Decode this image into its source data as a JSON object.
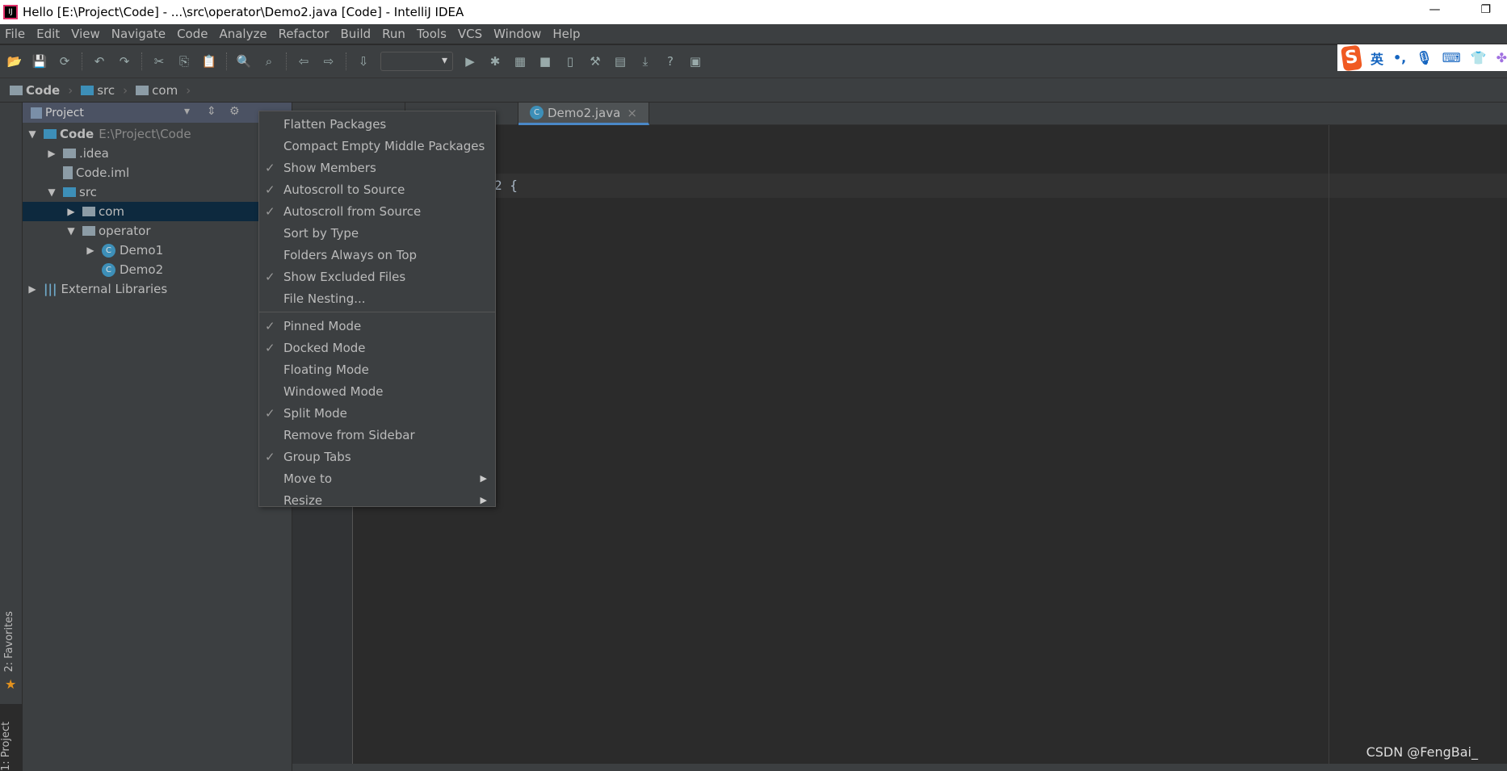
{
  "window": {
    "title": "Hello [E:\\Project\\Code] - ...\\src\\operator\\Demo2.java [Code] - IntelliJ IDEA",
    "minimize": "—",
    "restore": "❐"
  },
  "menubar": [
    "File",
    "Edit",
    "View",
    "Navigate",
    "Code",
    "Analyze",
    "Refactor",
    "Build",
    "Run",
    "Tools",
    "VCS",
    "Window",
    "Help"
  ],
  "toolbar": {
    "icons": [
      "open-folder",
      "save",
      "sync",
      "undo",
      "redo",
      "cut",
      "copy",
      "paste",
      "find",
      "replace",
      "back",
      "forward",
      "build",
      "run",
      "debug",
      "coverage",
      "stop",
      "device",
      "project-structure",
      "sdk",
      "vcs-update",
      "help",
      "sdk-manager"
    ]
  },
  "ime": {
    "logo": "S",
    "lang": "英",
    "punct": "•,"
  },
  "breadcrumb": [
    "Code",
    "src",
    "com"
  ],
  "stripe": {
    "favorites": "2: Favorites",
    "project": "1: Project"
  },
  "panel": {
    "title": "Project",
    "tree": [
      {
        "label": "Code",
        "extra": "E:\\Project\\Code",
        "arrow": "▼",
        "depth": 0,
        "icon": "module"
      },
      {
        "label": ".idea",
        "arrow": "▶",
        "depth": 1,
        "icon": "folder"
      },
      {
        "label": "Code.iml",
        "arrow": "",
        "depth": 1,
        "icon": "file"
      },
      {
        "label": "src",
        "arrow": "▼",
        "depth": 1,
        "icon": "source-folder"
      },
      {
        "label": "com",
        "arrow": "▶",
        "depth": 2,
        "icon": "package",
        "selected": true
      },
      {
        "label": "operator",
        "arrow": "▼",
        "depth": 2,
        "icon": "package"
      },
      {
        "label": "Demo1",
        "arrow": "▶",
        "depth": 3,
        "icon": "class"
      },
      {
        "label": "Demo2",
        "arrow": "",
        "depth": 3,
        "icon": "class"
      },
      {
        "label": "External Libraries",
        "arrow": "▶",
        "depth": 0,
        "icon": "libraries"
      }
    ]
  },
  "tabs": [
    {
      "label": ""
    },
    {
      "label": ""
    },
    {
      "label": "Demo2.java",
      "close": "×",
      "active": true
    }
  ],
  "editor": {
    "visible_code": "2 {"
  },
  "context_menu": [
    {
      "label": "Flatten Packages",
      "checked": false
    },
    {
      "label": "Compact Empty Middle Packages",
      "checked": false
    },
    {
      "label": "Show Members",
      "checked": true
    },
    {
      "label": "Autoscroll to Source",
      "checked": true
    },
    {
      "label": "Autoscroll from Source",
      "checked": true
    },
    {
      "label": "Sort by Type",
      "checked": false
    },
    {
      "label": "Folders Always on Top",
      "checked": false
    },
    {
      "label": "Show Excluded Files",
      "checked": true
    },
    {
      "label": "File Nesting...",
      "checked": false,
      "sep_after": true
    },
    {
      "label": "Pinned Mode",
      "checked": true
    },
    {
      "label": "Docked Mode",
      "checked": true
    },
    {
      "label": "Floating Mode",
      "checked": false
    },
    {
      "label": "Windowed Mode",
      "checked": false
    },
    {
      "label": "Split Mode",
      "checked": true
    },
    {
      "label": "Remove from Sidebar",
      "checked": false
    },
    {
      "label": "Group Tabs",
      "checked": true
    },
    {
      "label": "Move to",
      "checked": false,
      "submenu": true
    },
    {
      "label": "Resize",
      "checked": false,
      "submenu": true
    }
  ],
  "watermark": "CSDN @FengBai_",
  "colors": {
    "selection": "#0d293e",
    "accent": "#4a88c7",
    "panel": "#3c3f41",
    "editor": "#2b2b2b"
  }
}
